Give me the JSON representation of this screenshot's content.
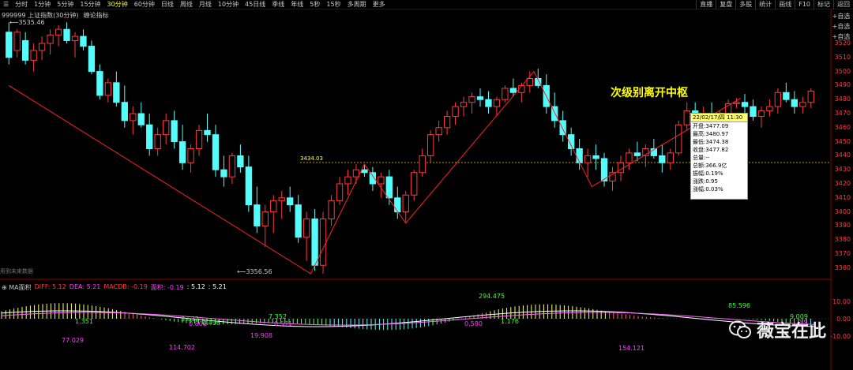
{
  "toolbar": {
    "timeframes": [
      {
        "label": "分时",
        "active": false
      },
      {
        "label": "1分钟",
        "active": false
      },
      {
        "label": "5分钟",
        "active": false
      },
      {
        "label": "15分钟",
        "active": false
      },
      {
        "label": "30分钟",
        "active": true
      },
      {
        "label": "60分钟",
        "active": false
      },
      {
        "label": "日线",
        "active": false
      },
      {
        "label": "周线",
        "active": false
      },
      {
        "label": "月线",
        "active": false
      },
      {
        "label": "10分钟",
        "active": false
      },
      {
        "label": "45日线",
        "active": false
      },
      {
        "label": "季线",
        "active": false
      },
      {
        "label": "年线",
        "active": false
      },
      {
        "label": "5秒",
        "active": false
      },
      {
        "label": "15秒",
        "active": false
      },
      {
        "label": "多周期",
        "active": false
      },
      {
        "label": "更多",
        "active": false
      }
    ],
    "right_menu": [
      "直播",
      "复盘",
      "多股",
      "统计",
      "画线",
      "F10",
      "标记",
      "返回"
    ],
    "side_buttons": [
      "+自选",
      "+自选",
      "+自选"
    ]
  },
  "legend": {
    "code": "999999 上证指数(30分钟)",
    "indicator": "缠论指标"
  },
  "labels": {
    "high": "3535.46",
    "low": "3356.56",
    "mid": "3434.03",
    "annotation": "次级别离开中枢",
    "no_data": "用到未来数据"
  },
  "price_axis": [
    "3520",
    "3510",
    "3500",
    "3490",
    "3480",
    "3470",
    "3460",
    "3450",
    "3440",
    "3430",
    "3420",
    "3410",
    "3400",
    "3390",
    "3380",
    "3370",
    "3360"
  ],
  "macd": {
    "legend": {
      "name": "MA面积",
      "diff": "DIFF: 5.12",
      "dea": "DEA: 5.21",
      "macd": "MACDB: -0.19",
      "area": "面积: -0.19",
      "v1": ": 5.12",
      "v2": ": 5.21"
    },
    "axis": [
      "10.00",
      "0.00",
      "-10.00"
    ],
    "values": [
      {
        "text": "1.351",
        "color": "#3bff3b"
      },
      {
        "text": "77.029",
        "color": "#ff3bff"
      },
      {
        "text": "114.702",
        "color": "#ff3bff"
      },
      {
        "text": "3.632",
        "color": "#3bff3b"
      },
      {
        "text": "0.806",
        "color": "#ff3bff"
      },
      {
        "text": "0.496",
        "color": "#3bff3b"
      },
      {
        "text": "19.908",
        "color": "#ff3bff"
      },
      {
        "text": "7.352",
        "color": "#3bff3b"
      },
      {
        "text": "0.571",
        "color": "#ff3bff"
      },
      {
        "text": "294.475",
        "color": "#3bff3b"
      },
      {
        "text": "0.580",
        "color": "#ff3bff"
      },
      {
        "text": "1.176",
        "color": "#3bff3b"
      },
      {
        "text": "154.121",
        "color": "#ff3bff"
      },
      {
        "text": "85.596",
        "color": "#3bff3b"
      },
      {
        "text": "9.009",
        "color": "#3bff3b"
      },
      {
        "text": "0.9",
        "color": "#ff3bff"
      }
    ]
  },
  "infobox": {
    "header": "22/02/17/四 11:30",
    "rows": [
      "开盘:3477.09",
      "最高:3480.97",
      "最低:3474.38",
      "收盘:3477.82",
      "总量:--",
      "总额:366.9亿",
      "振幅:0.19%",
      "涨跌:0.95",
      "涨幅:0.03%"
    ]
  },
  "watermark": {
    "text": "薇宝在此"
  },
  "colors": {
    "up": "#ff3b3b",
    "down": "#54fcfc",
    "accent": "#ffff00"
  }
}
